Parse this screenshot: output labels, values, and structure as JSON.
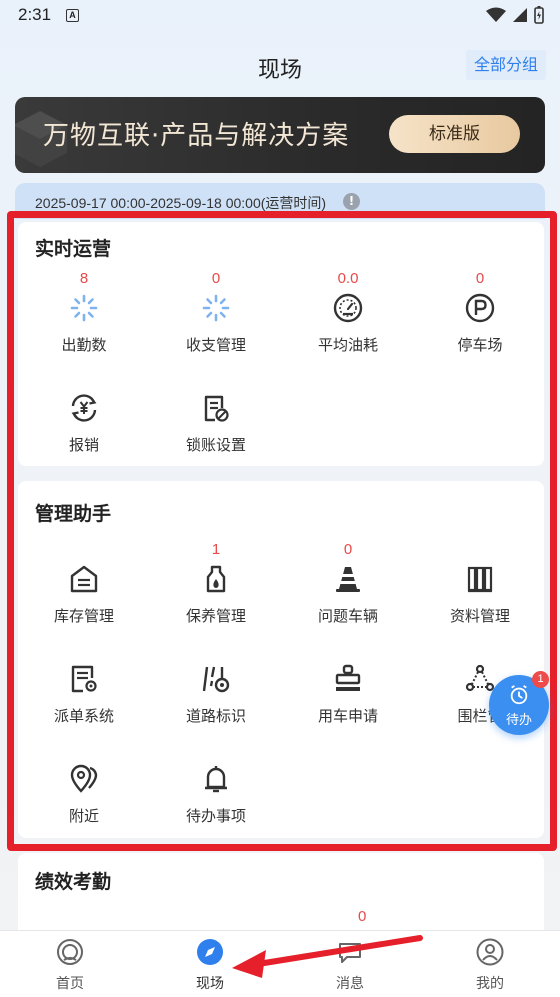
{
  "status": {
    "time": "2:31",
    "notif": "A"
  },
  "header": {
    "title": "现场",
    "group_button": "全部分组"
  },
  "banner": {
    "text": "万物互联·产品与解决方案",
    "button": "标准版"
  },
  "date_strip": {
    "text": "2025-09-17 00:00-2025-09-18 00:00(运营时间)",
    "info": "!"
  },
  "realtime": {
    "title": "实时运营",
    "items": [
      {
        "label": "出勤数",
        "count": "8",
        "icon": "loading-icon"
      },
      {
        "label": "收支管理",
        "count": "0",
        "icon": "loading-icon"
      },
      {
        "label": "平均油耗",
        "count": "0.0",
        "icon": "gauge-icon"
      },
      {
        "label": "停车场",
        "count": "0",
        "icon": "parking-icon"
      },
      {
        "label": "报销",
        "count": "",
        "icon": "yen-refresh-icon"
      },
      {
        "label": "锁账设置",
        "count": "",
        "icon": "document-lock-icon"
      }
    ]
  },
  "assistant": {
    "title": "管理助手",
    "items": [
      {
        "label": "库存管理",
        "count": "",
        "icon": "warehouse-icon"
      },
      {
        "label": "保养管理",
        "count": "1",
        "icon": "oil-bottle-icon"
      },
      {
        "label": "问题车辆",
        "count": "0",
        "icon": "traffic-cone-icon"
      },
      {
        "label": "资料管理",
        "count": "",
        "icon": "binders-icon"
      },
      {
        "label": "派单系统",
        "count": "",
        "icon": "dispatch-doc-icon"
      },
      {
        "label": "道路标识",
        "count": "",
        "icon": "road-sign-icon"
      },
      {
        "label": "用车申请",
        "count": "",
        "icon": "stamp-icon"
      },
      {
        "label": "围栏管",
        "count": "",
        "icon": "fence-icon"
      },
      {
        "label": "附近",
        "count": "",
        "icon": "location-pins-icon"
      },
      {
        "label": "待办事项",
        "count": "",
        "icon": "bell-icon"
      }
    ]
  },
  "performance": {
    "title": "绩效考勤",
    "count": "0"
  },
  "float_button": {
    "label": "待办",
    "badge": "1"
  },
  "tabbar": {
    "items": [
      {
        "label": "首页",
        "icon": "home-target-icon"
      },
      {
        "label": "现场",
        "icon": "compass-icon"
      },
      {
        "label": "消息",
        "icon": "message-icon"
      },
      {
        "label": "我的",
        "icon": "user-icon"
      }
    ]
  },
  "colors": {
    "accent": "#2f80ed",
    "badge": "#e84a4a",
    "frame": "#e6202a",
    "float": "#3b8ff0"
  }
}
